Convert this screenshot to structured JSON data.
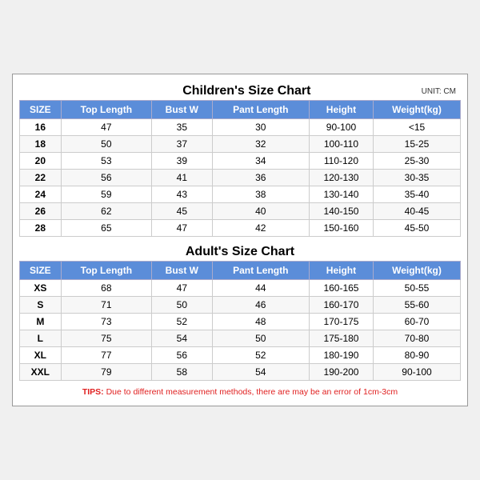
{
  "children": {
    "title": "Children's Size Chart",
    "unit": "UNIT: CM",
    "headers": [
      "SIZE",
      "Top Length",
      "Bust W",
      "Pant Length",
      "Height",
      "Weight(kg)"
    ],
    "rows": [
      [
        "16",
        "47",
        "35",
        "30",
        "90-100",
        "<15"
      ],
      [
        "18",
        "50",
        "37",
        "32",
        "100-110",
        "15-25"
      ],
      [
        "20",
        "53",
        "39",
        "34",
        "110-120",
        "25-30"
      ],
      [
        "22",
        "56",
        "41",
        "36",
        "120-130",
        "30-35"
      ],
      [
        "24",
        "59",
        "43",
        "38",
        "130-140",
        "35-40"
      ],
      [
        "26",
        "62",
        "45",
        "40",
        "140-150",
        "40-45"
      ],
      [
        "28",
        "65",
        "47",
        "42",
        "150-160",
        "45-50"
      ]
    ]
  },
  "adults": {
    "title": "Adult's Size Chart",
    "headers": [
      "SIZE",
      "Top Length",
      "Bust W",
      "Pant Length",
      "Height",
      "Weight(kg)"
    ],
    "rows": [
      [
        "XS",
        "68",
        "47",
        "44",
        "160-165",
        "50-55"
      ],
      [
        "S",
        "71",
        "50",
        "46",
        "160-170",
        "55-60"
      ],
      [
        "M",
        "73",
        "52",
        "48",
        "170-175",
        "60-70"
      ],
      [
        "L",
        "75",
        "54",
        "50",
        "175-180",
        "70-80"
      ],
      [
        "XL",
        "77",
        "56",
        "52",
        "180-190",
        "80-90"
      ],
      [
        "XXL",
        "79",
        "58",
        "54",
        "190-200",
        "90-100"
      ]
    ]
  },
  "tips": {
    "label": "TIPS:",
    "text": " Due to different measurement methods, there are may be an error of 1cm-3cm"
  }
}
